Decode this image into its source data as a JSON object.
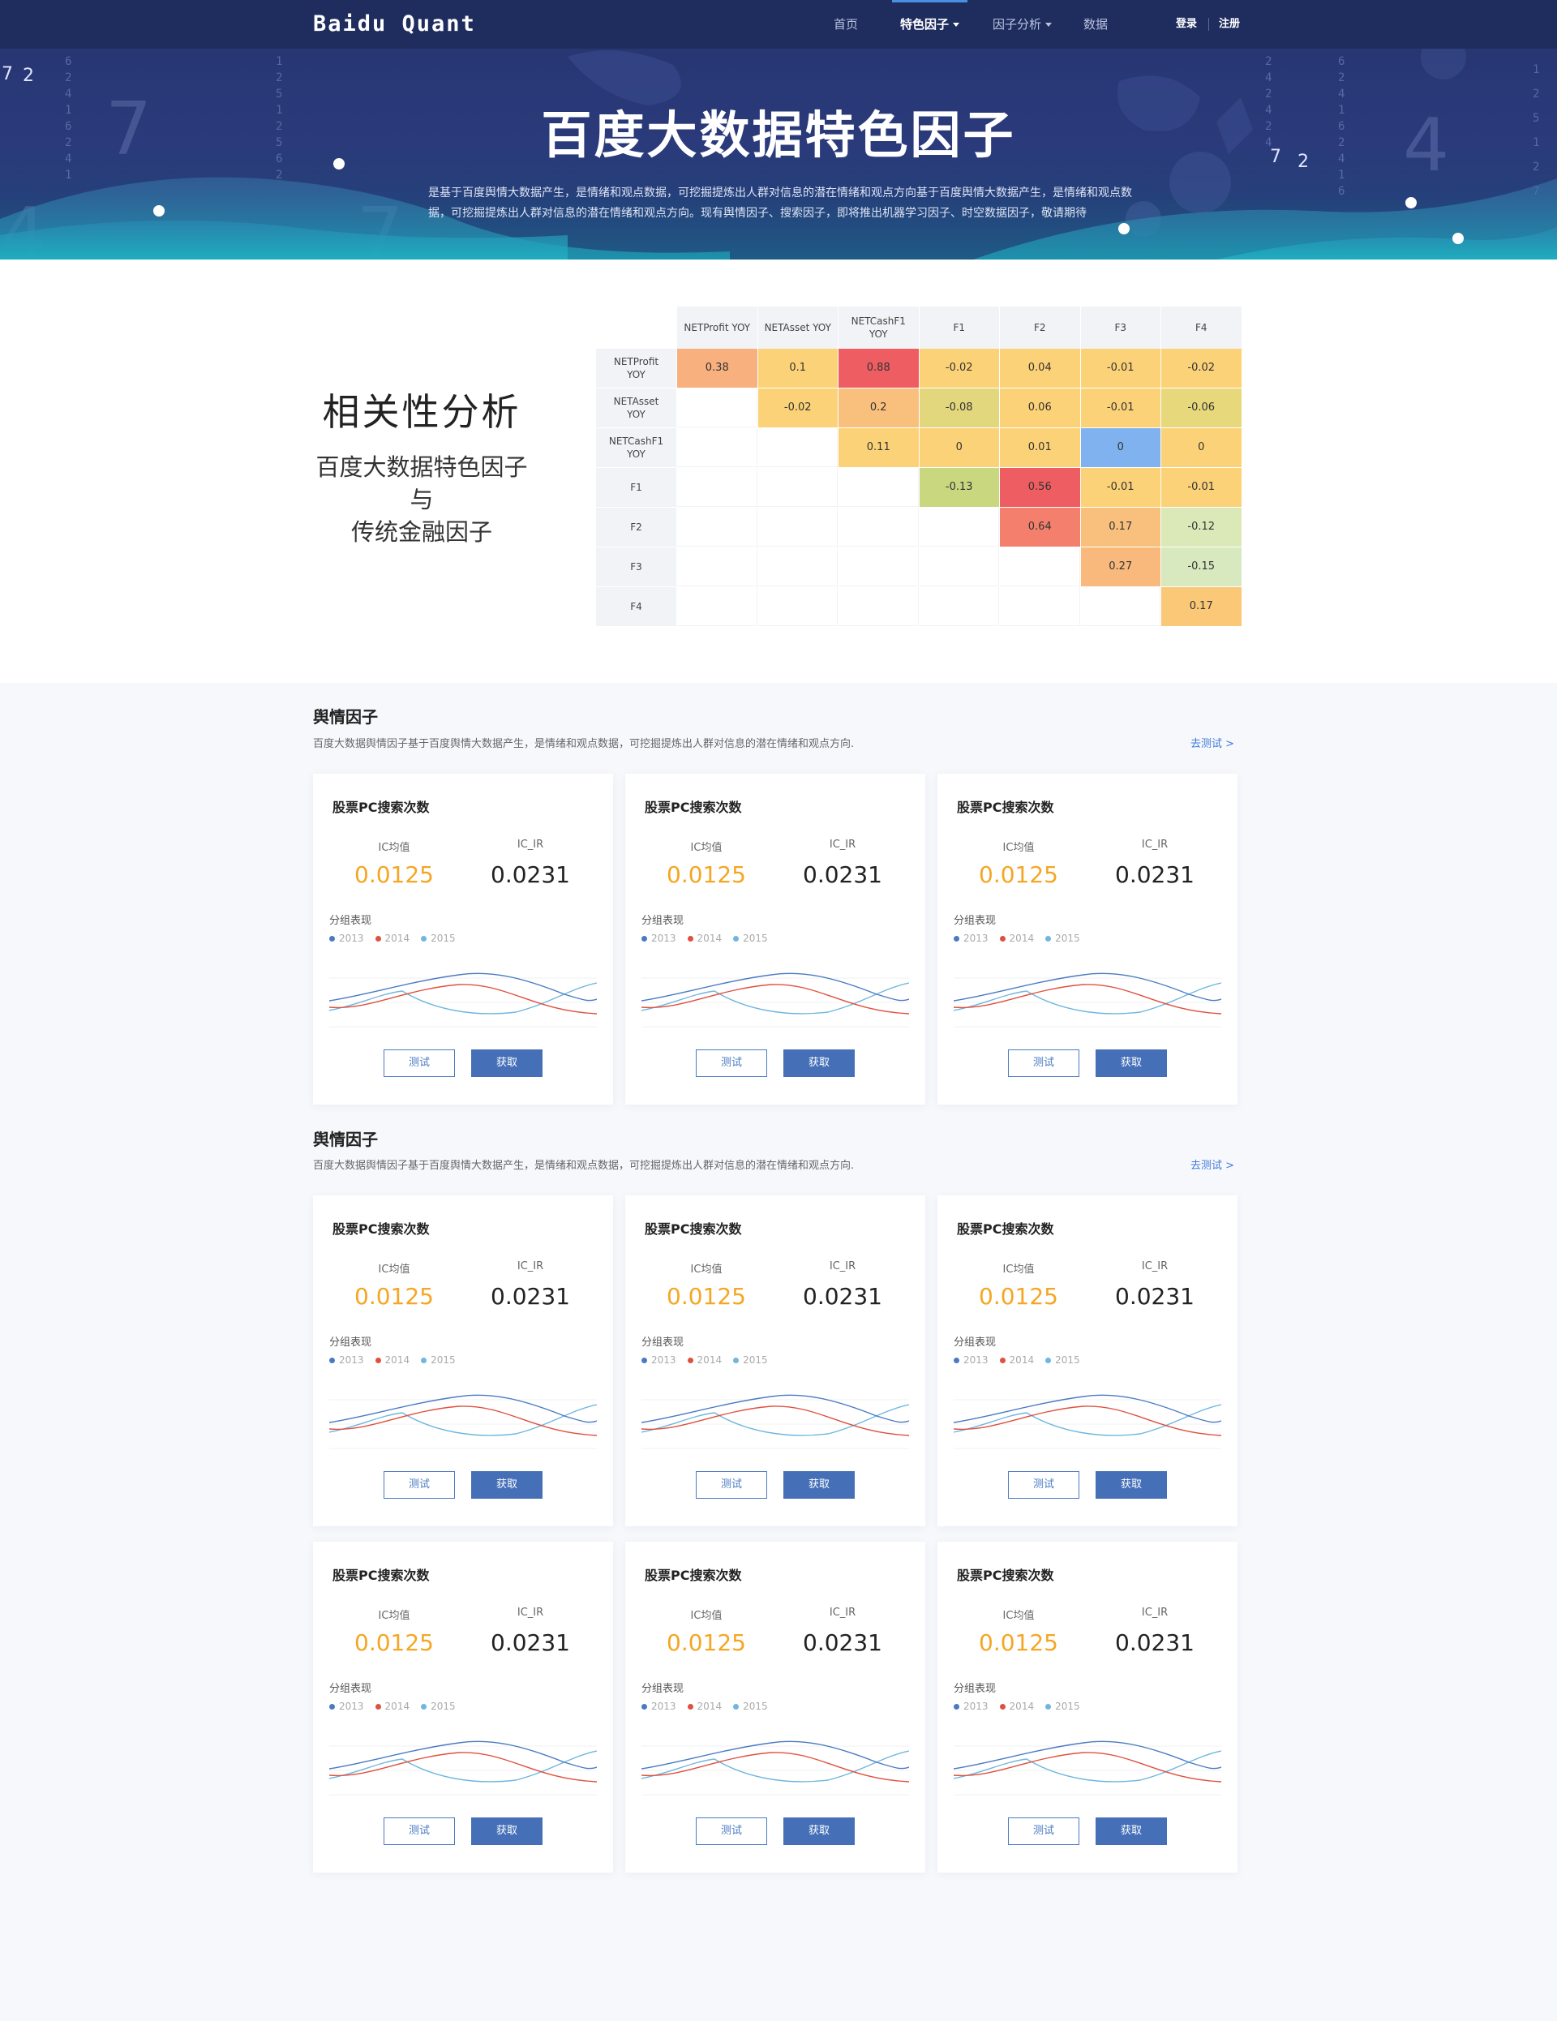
{
  "nav": {
    "brand": "Baidu Quant",
    "items": [
      {
        "label": "首页",
        "dropdown": false,
        "active": false
      },
      {
        "label": "特色因子",
        "dropdown": true,
        "active": true
      },
      {
        "label": "因子分析",
        "dropdown": true,
        "active": false
      },
      {
        "label": "数据",
        "dropdown": false,
        "active": false
      }
    ],
    "login": "登录",
    "register": "注册"
  },
  "hero": {
    "title": "百度大数据特色因子",
    "description": "是基于百度舆情大数据产生，是情绪和观点数据，可挖掘提炼出人群对信息的潜在情绪和观点方向基于百度舆情大数据产生，是情绪和观点数据，可挖掘提炼出人群对信息的潜在情绪和观点方向。现有舆情因子、搜索因子，即将推出机器学习因子、时空数据因子，敬请期待"
  },
  "correlation": {
    "title": "相关性分析",
    "subtitle_line1": "百度大数据特色因子",
    "subtitle_line2": "与",
    "subtitle_line3": "传统金融因子",
    "columns": [
      "NETProfit YOY",
      "NETAsset YOY",
      "NETCashF1 YOY",
      "F1",
      "F2",
      "F3",
      "F4"
    ],
    "rows": [
      "NETProfit YOY",
      "NETAsset YOY",
      "NETCashF1 YOY",
      "F1",
      "F2",
      "F3",
      "F4"
    ],
    "cells": [
      [
        {
          "v": "0.38",
          "c": "#f7b07e"
        },
        {
          "v": "0.1",
          "c": "#fbd277"
        },
        {
          "v": "0.88",
          "c": "#ee5d62"
        },
        {
          "v": "-0.02",
          "c": "#fbd277"
        },
        {
          "v": "0.04",
          "c": "#fbd277"
        },
        {
          "v": "-0.01",
          "c": "#fbd277"
        },
        {
          "v": "-0.02",
          "c": "#fbd277"
        }
      ],
      [
        null,
        {
          "v": "-0.02",
          "c": "#fbd277"
        },
        {
          "v": "0.2",
          "c": "#f9c07d"
        },
        {
          "v": "-0.08",
          "c": "#e2d77c"
        },
        {
          "v": "0.06",
          "c": "#fbd277"
        },
        {
          "v": "-0.01",
          "c": "#fbd277"
        },
        {
          "v": "-0.06",
          "c": "#e7d87c"
        }
      ],
      [
        null,
        null,
        {
          "v": "0.11",
          "c": "#fbd277"
        },
        {
          "v": "0",
          "c": "#fbd277"
        },
        {
          "v": "0.01",
          "c": "#fbd277"
        },
        {
          "v": "0",
          "c": "#7fb2ee"
        },
        {
          "v": "0",
          "c": "#fbd277"
        }
      ],
      [
        null,
        null,
        null,
        {
          "v": "-0.13",
          "c": "#c9d77f"
        },
        {
          "v": "0.56",
          "c": "#ee5d62"
        },
        {
          "v": "-0.01",
          "c": "#fbd277"
        },
        {
          "v": "-0.01",
          "c": "#fbd277"
        }
      ],
      [
        null,
        null,
        null,
        null,
        {
          "v": "0.64",
          "c": "#f47f6c"
        },
        {
          "v": "0.17",
          "c": "#f9c07d"
        },
        {
          "v": "-0.12",
          "c": "#dbe8b8"
        }
      ],
      [
        null,
        null,
        null,
        null,
        null,
        {
          "v": "0.27",
          "c": "#f9b97d"
        },
        {
          "v": "-0.15",
          "c": "#d8e8bf"
        }
      ],
      [
        null,
        null,
        null,
        null,
        null,
        null,
        {
          "v": "0.17",
          "c": "#fbc877"
        }
      ]
    ]
  },
  "sections": [
    {
      "title": "舆情因子",
      "description": "百度大数据舆情因子基于百度舆情大数据产生，是情绪和观点数据，可挖掘提炼出人群对信息的潜在情绪和观点方向.",
      "link": "去测试 >"
    },
    {
      "title": "舆情因子",
      "description": "百度大数据舆情因子基于百度舆情大数据产生，是情绪和观点数据，可挖掘提炼出人群对信息的潜在情绪和观点方向.",
      "link": "去测试 >"
    }
  ],
  "card": {
    "title": "股票PC搜索次数",
    "ic_mean_label": "IC均值",
    "ic_mean_value": "0.0125",
    "ic_ir_label": "IC_IR",
    "ic_ir_value": "0.0231",
    "group_label": "分组表现",
    "legend": [
      {
        "name": "2013",
        "color": "#4a7ac2"
      },
      {
        "name": "2014",
        "color": "#e0503e"
      },
      {
        "name": "2015",
        "color": "#6fb7df"
      }
    ],
    "test_button": "测试",
    "get_button": "获取"
  },
  "colors": {
    "nav_bg": "#1f2d5e",
    "accent_orange": "#f5a623",
    "button_blue": "#4570b8",
    "link_blue": "#3f7bd9"
  }
}
